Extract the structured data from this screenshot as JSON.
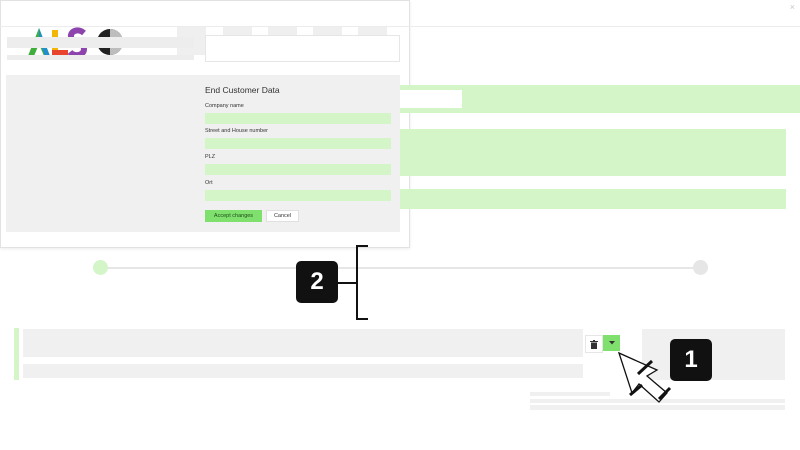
{
  "brand": {
    "logo_text": "ALSO"
  },
  "modal": {
    "close_icon": "×",
    "form": {
      "title": "End Customer Data",
      "fields": [
        {
          "label": "Company name",
          "value": ""
        },
        {
          "label": "Street and House number",
          "value": ""
        },
        {
          "label": "PLZ",
          "value": ""
        },
        {
          "label": "Ort",
          "value": ""
        }
      ],
      "accept_label": "Accept changes",
      "cancel_label": "Cancel"
    }
  },
  "row_actions": {
    "delete_icon": "trash-icon",
    "dropdown_icon": "caret-down-icon"
  },
  "callouts": {
    "step1": "1",
    "step2": "2"
  },
  "colors": {
    "accent_light": "#d4f5c8",
    "accent": "#7fe06e",
    "badge": "#111111"
  }
}
